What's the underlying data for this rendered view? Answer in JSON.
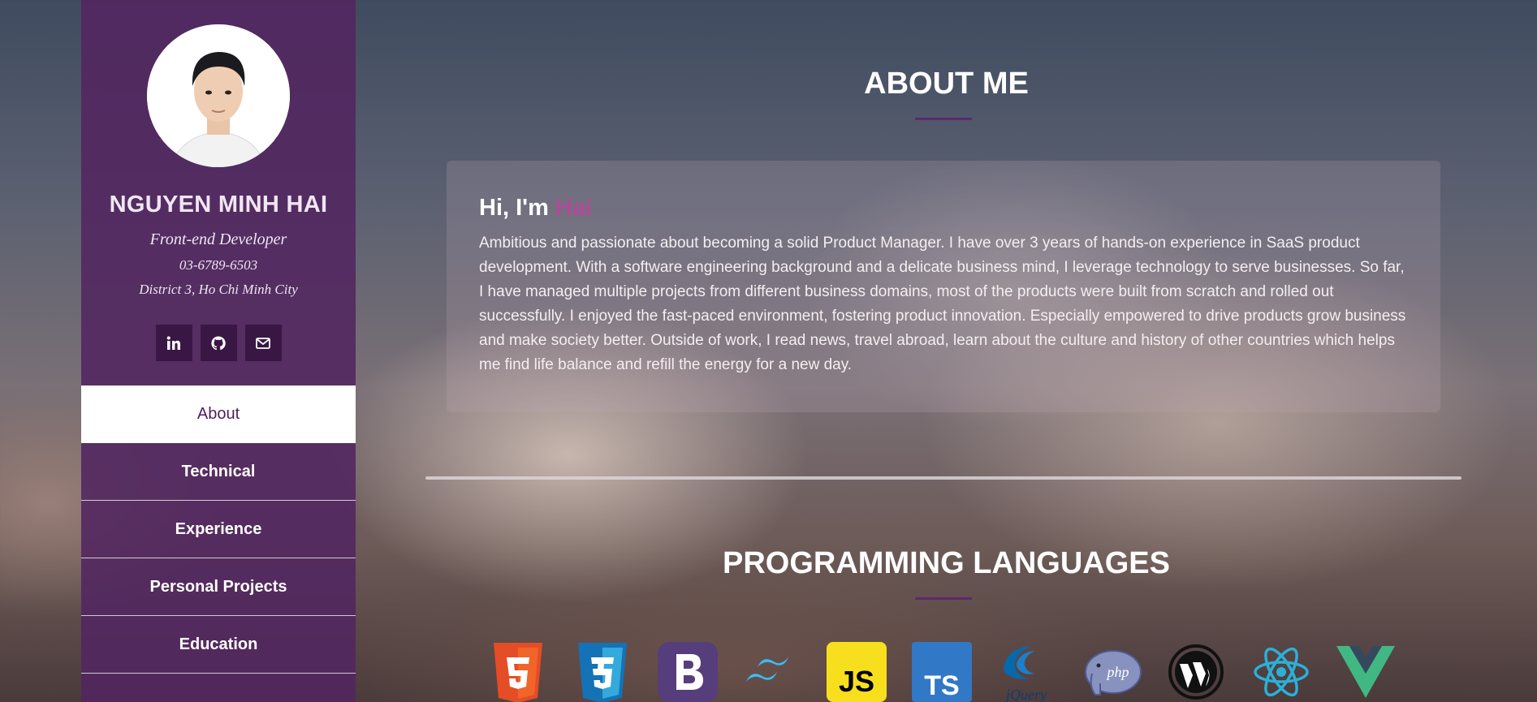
{
  "profile": {
    "name": "NGUYEN MINH HAI",
    "role": "Front-end Developer",
    "phone": "03-6789-6503",
    "address": "District 3, Ho Chi Minh City"
  },
  "social": {
    "linkedin": "linkedin-icon",
    "github": "github-icon",
    "email": "envelope-icon"
  },
  "nav": {
    "about": "About",
    "technical": "Technical",
    "experience": "Experience",
    "projects": "Personal Projects",
    "education": "Education"
  },
  "about": {
    "title": "ABOUT ME",
    "greeting_prefix": "Hi, I'm ",
    "greeting_name": "Hai",
    "bio": "Ambitious and passionate about becoming a solid Product Manager. I have over 3 years of hands-on experience in SaaS product development. With a software engineering background and a delicate business mind, I leverage technology to serve businesses. So far, I have managed multiple projects from different business domains, most of the products were built from scratch and rolled out successfully. I enjoyed the fast-paced environment, fostering product innovation. Especially empowered to drive products grow business and make society better. Outside of work, I read news, travel abroad, learn about the culture and history of other countries which helps me find life balance and refill the energy for a new day."
  },
  "programming": {
    "title": "PROGRAMMING LANGUAGES",
    "icons": {
      "html5": "html5-icon",
      "css3": "css3-icon",
      "bootstrap": "bootstrap-icon",
      "tailwind": "tailwind-icon",
      "js": "JS",
      "ts": "TS",
      "jquery": "jQuery",
      "php": "php",
      "wordpress": "wordpress-icon",
      "react": "react-icon",
      "vue": "vue-icon"
    }
  },
  "colors": {
    "sidebar": "#522660",
    "accent": "#b14a97",
    "nav_active_text": "#4e1f5e"
  }
}
